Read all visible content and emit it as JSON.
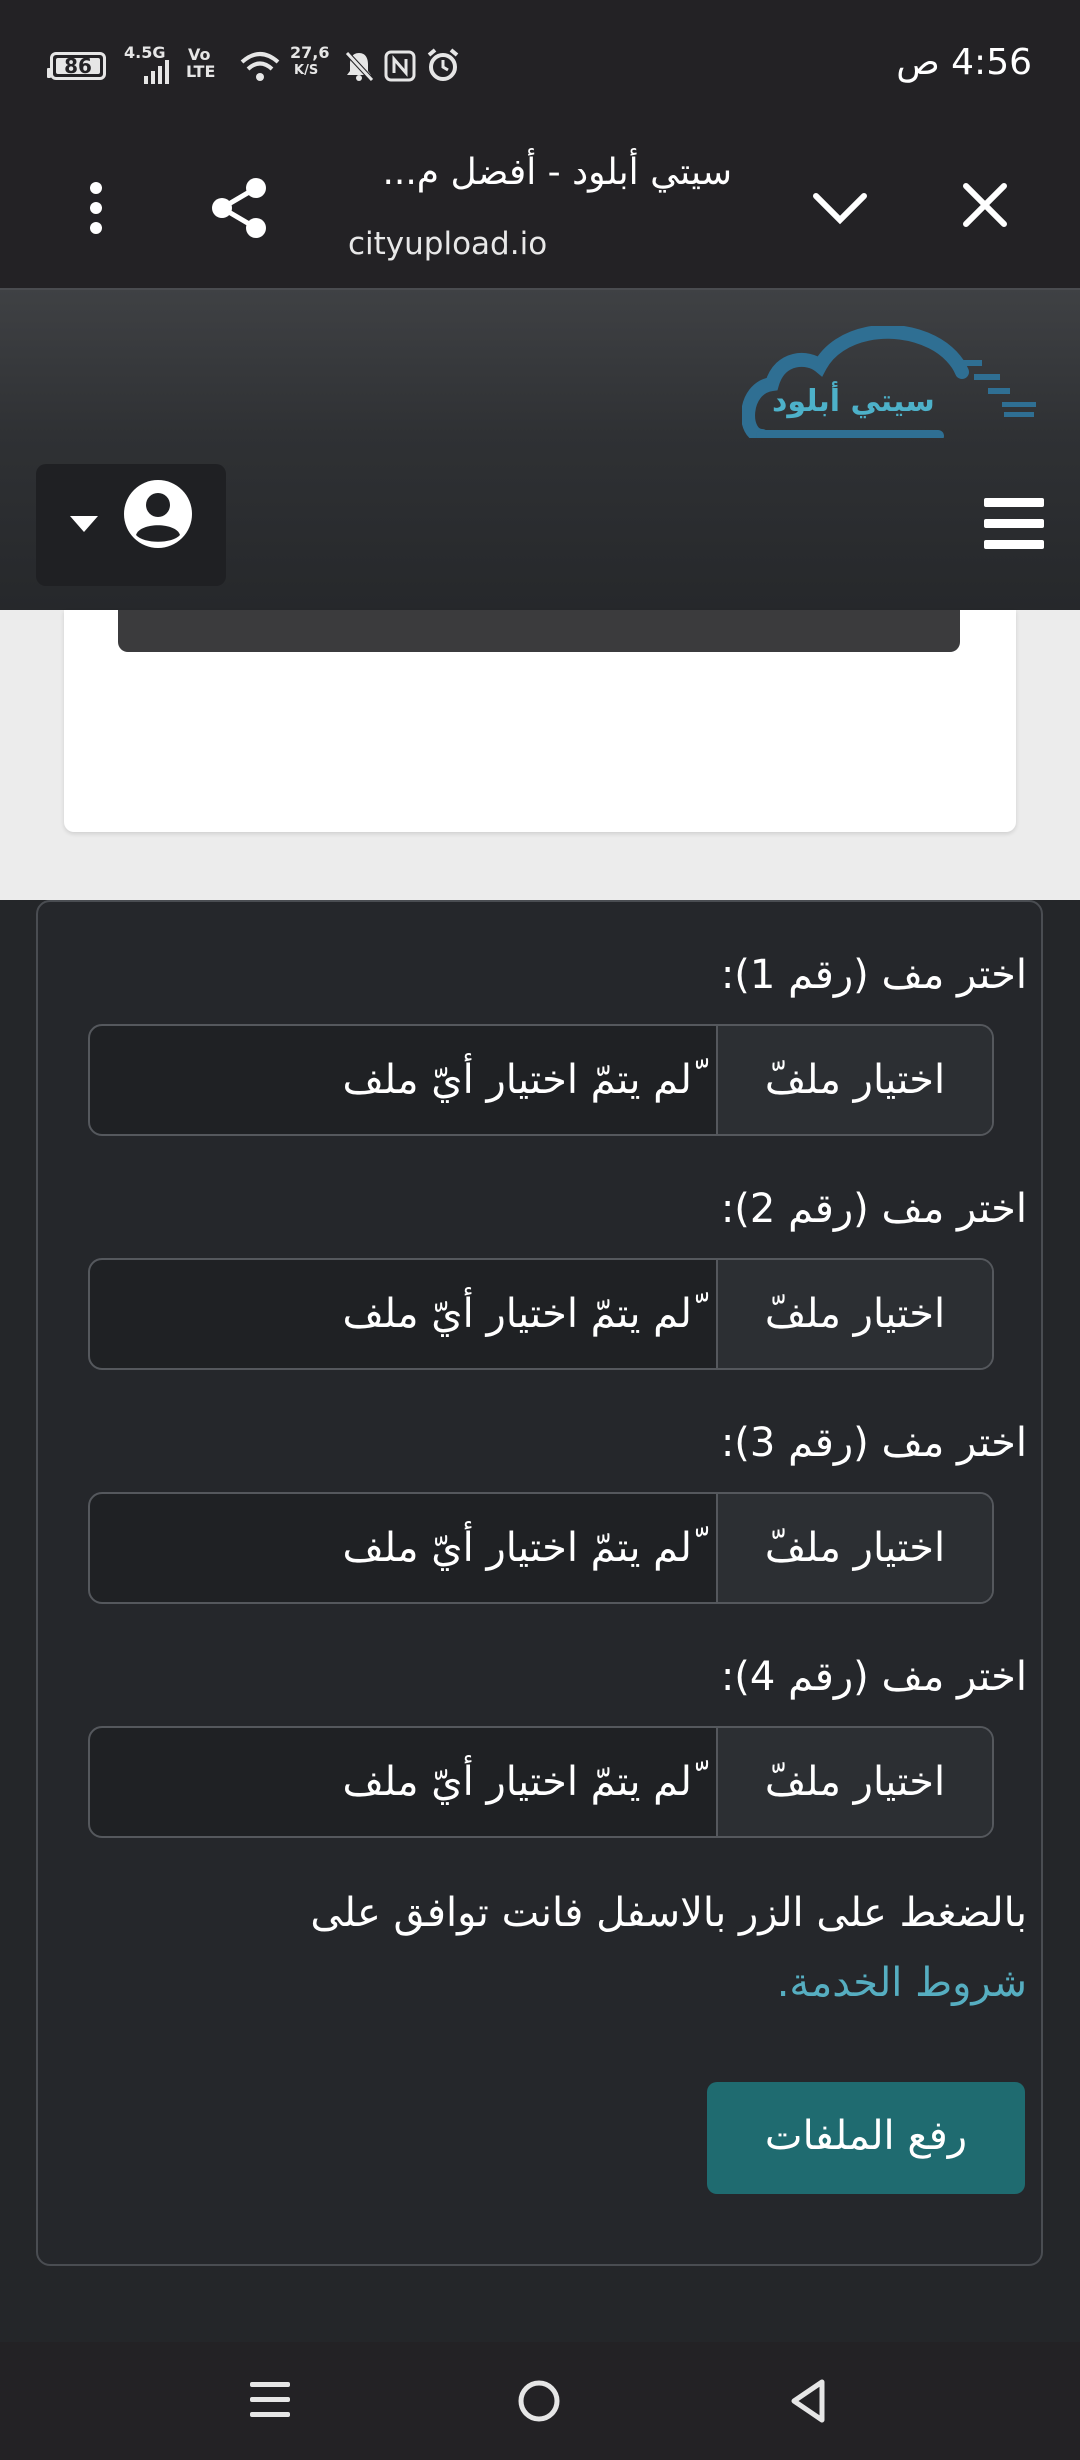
{
  "status_bar": {
    "time": "4:56 ص",
    "battery": "86",
    "network": "4.5G",
    "volte_top": "Vo",
    "volte_bottom": "LTE",
    "speed_value": "27,6",
    "speed_unit": "K/S"
  },
  "browser": {
    "title": "سيتي أبلود - أفضل م...",
    "url": "cityupload.io"
  },
  "header": {
    "logo_text": "سيتي أبلود"
  },
  "upload_form": {
    "fields": [
      {
        "label": "اختر مف (رقم 1):",
        "button_label": "اختيار ملفّ",
        "status": "ّلم يتمّ اختيار أيّ ملف"
      },
      {
        "label": "اختر مف (رقم 2):",
        "button_label": "اختيار ملفّ",
        "status": "ّلم يتمّ اختيار أيّ ملف"
      },
      {
        "label": "اختر مف (رقم 3):",
        "button_label": "اختيار ملفّ",
        "status": "ّلم يتمّ اختيار أيّ ملف"
      },
      {
        "label": "اختر مف (رقم 4):",
        "button_label": "اختيار ملفّ",
        "status": "ّلم يتمّ اختيار أيّ ملف"
      }
    ],
    "terms_text": "بالضغط على الزر بالاسفل فانت توافق على",
    "terms_link": "شروط الخدمة.",
    "submit_label": "رفع الملفات"
  },
  "colors": {
    "accent": "#1f6b70",
    "link": "#56aec1",
    "logo": "#2f7fa3"
  },
  "icons": [
    "more-vert-icon",
    "share-icon",
    "chevron-down-icon",
    "close-icon",
    "user-avatar-icon",
    "caret-down-icon",
    "hamburger-menu-icon",
    "recents-icon",
    "home-icon",
    "back-icon"
  ]
}
